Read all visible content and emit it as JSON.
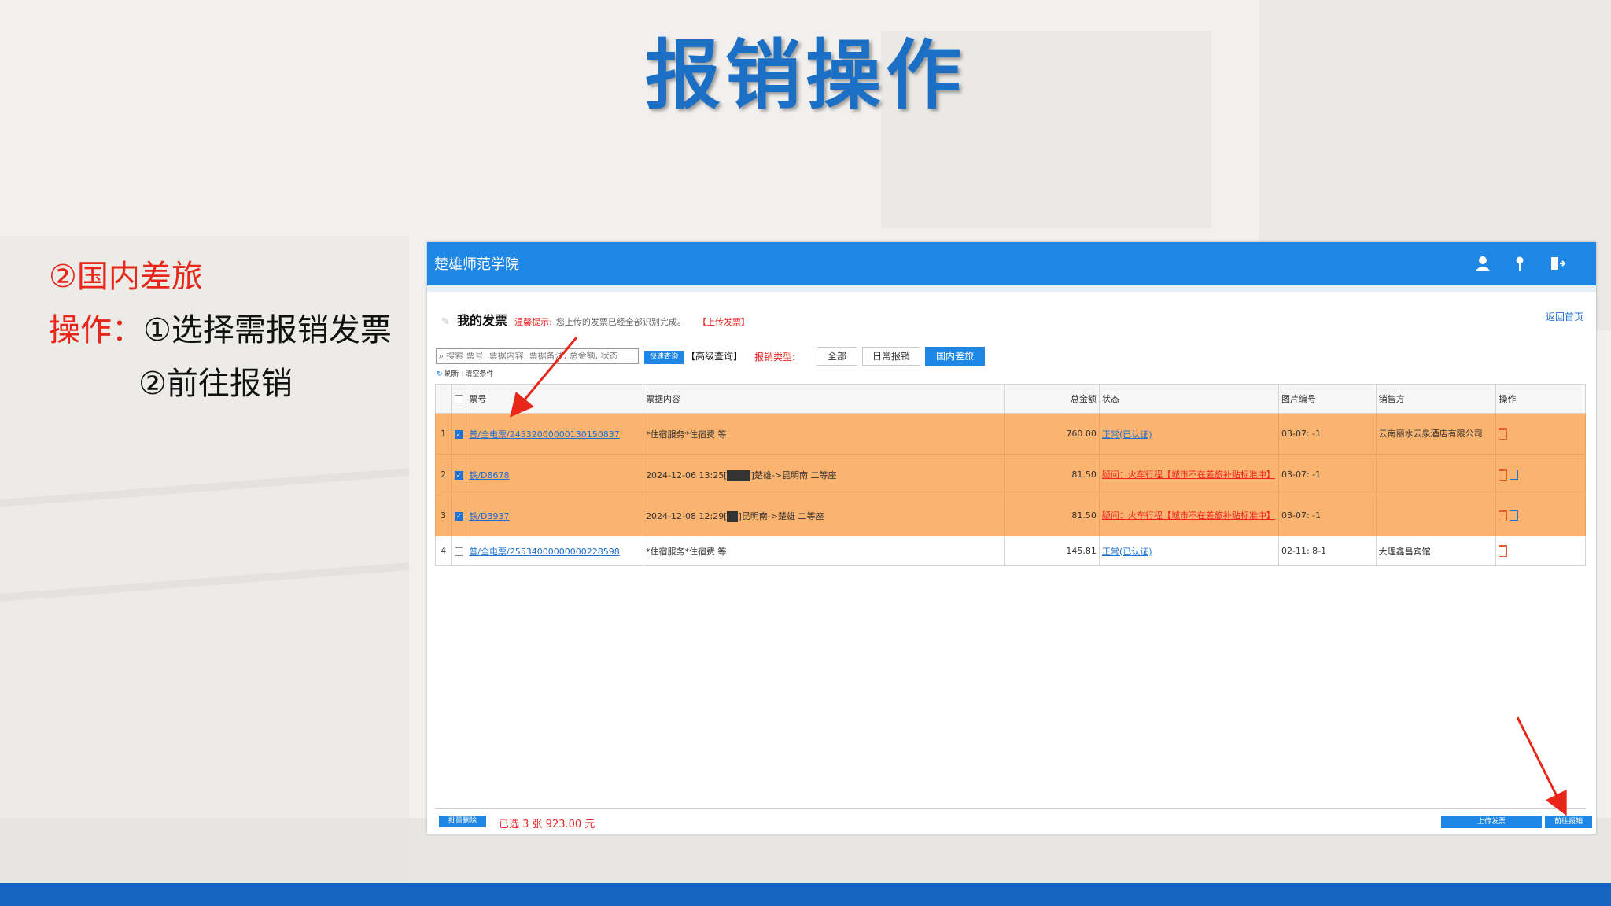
{
  "slide": {
    "title": "报销操作",
    "line1": "②国内差旅",
    "line2_label": "操作：",
    "line2_text": "①选择需报销发票",
    "line3_text": "②前往报销"
  },
  "app": {
    "brand": "楚雄师范学院",
    "header_icons": [
      "user-icon",
      "location-pin-icon",
      "logout-icon"
    ],
    "page_title": "我的发票",
    "tip_label": "温馨提示:",
    "tip_text": "您上传的发票已经全部识别完成。",
    "upload_link": "【上传发票】",
    "back_home": "返回首页",
    "search_placeholder": "搜索 票号, 票据内容, 票据备注, 总金额, 状态",
    "quick_search": "快速查询",
    "advanced_search": "【高级查询】",
    "type_label": "报销类型:",
    "type_tabs": [
      "全部",
      "日常报销",
      "国内差旅"
    ],
    "active_tab": "国内差旅",
    "refresh": "刷新",
    "clear": "清空条件",
    "columns": [
      "票号",
      "票据内容",
      "总金额",
      "状态",
      "图片编号",
      "销售方",
      "操作"
    ],
    "rows": [
      {
        "idx": "1",
        "checked": true,
        "ticket": "普/全电票/24532000000130150837",
        "content": "*住宿服务*住宿费 等",
        "amount": "760.00",
        "status": "正常(已认证)",
        "status_type": "normal",
        "image_no": "03-07: -1",
        "seller": "云南丽水云泉酒店有限公司"
      },
      {
        "idx": "2",
        "checked": true,
        "ticket": "铁/D8678",
        "content_prefix": "2024-12-06 13:25[",
        "content_suffix": "]楚雄->昆明南 二等座",
        "amount": "81.50",
        "status": "疑问：火车行程【城市不在差旅补贴标准中】",
        "status_type": "warn",
        "image_no": "03-07: -1",
        "seller": ""
      },
      {
        "idx": "3",
        "checked": true,
        "ticket": "铁/D3937",
        "content_prefix": "2024-12-08 12:29[",
        "content_suffix": "]昆明南->楚雄 二等座",
        "amount": "81.50",
        "status": "疑问：火车行程【城市不在差旅补贴标准中】",
        "status_type": "warn",
        "image_no": "03-07: -1",
        "seller": ""
      },
      {
        "idx": "4",
        "checked": false,
        "ticket": "普/全电票/25534000000000228598",
        "content": "*住宿服务*住宿费 等",
        "amount": "145.81",
        "status": "正常(已认证)",
        "status_type": "normal",
        "image_no": "02-11: 8-1",
        "seller": "大理鑫昌宾馆"
      }
    ],
    "batch_delete": "批量删除",
    "selected_info": "已选 3 张 923.00 元",
    "upload_invoice": "上传发票",
    "goto_reimburse": "前往报销"
  },
  "colors": {
    "header_blue": "#1e86e4",
    "selected_row": "#fbb46f",
    "title_blue": "#1b6fc4",
    "red_text": "#e8261a",
    "bottom_bar": "#1565c0"
  }
}
